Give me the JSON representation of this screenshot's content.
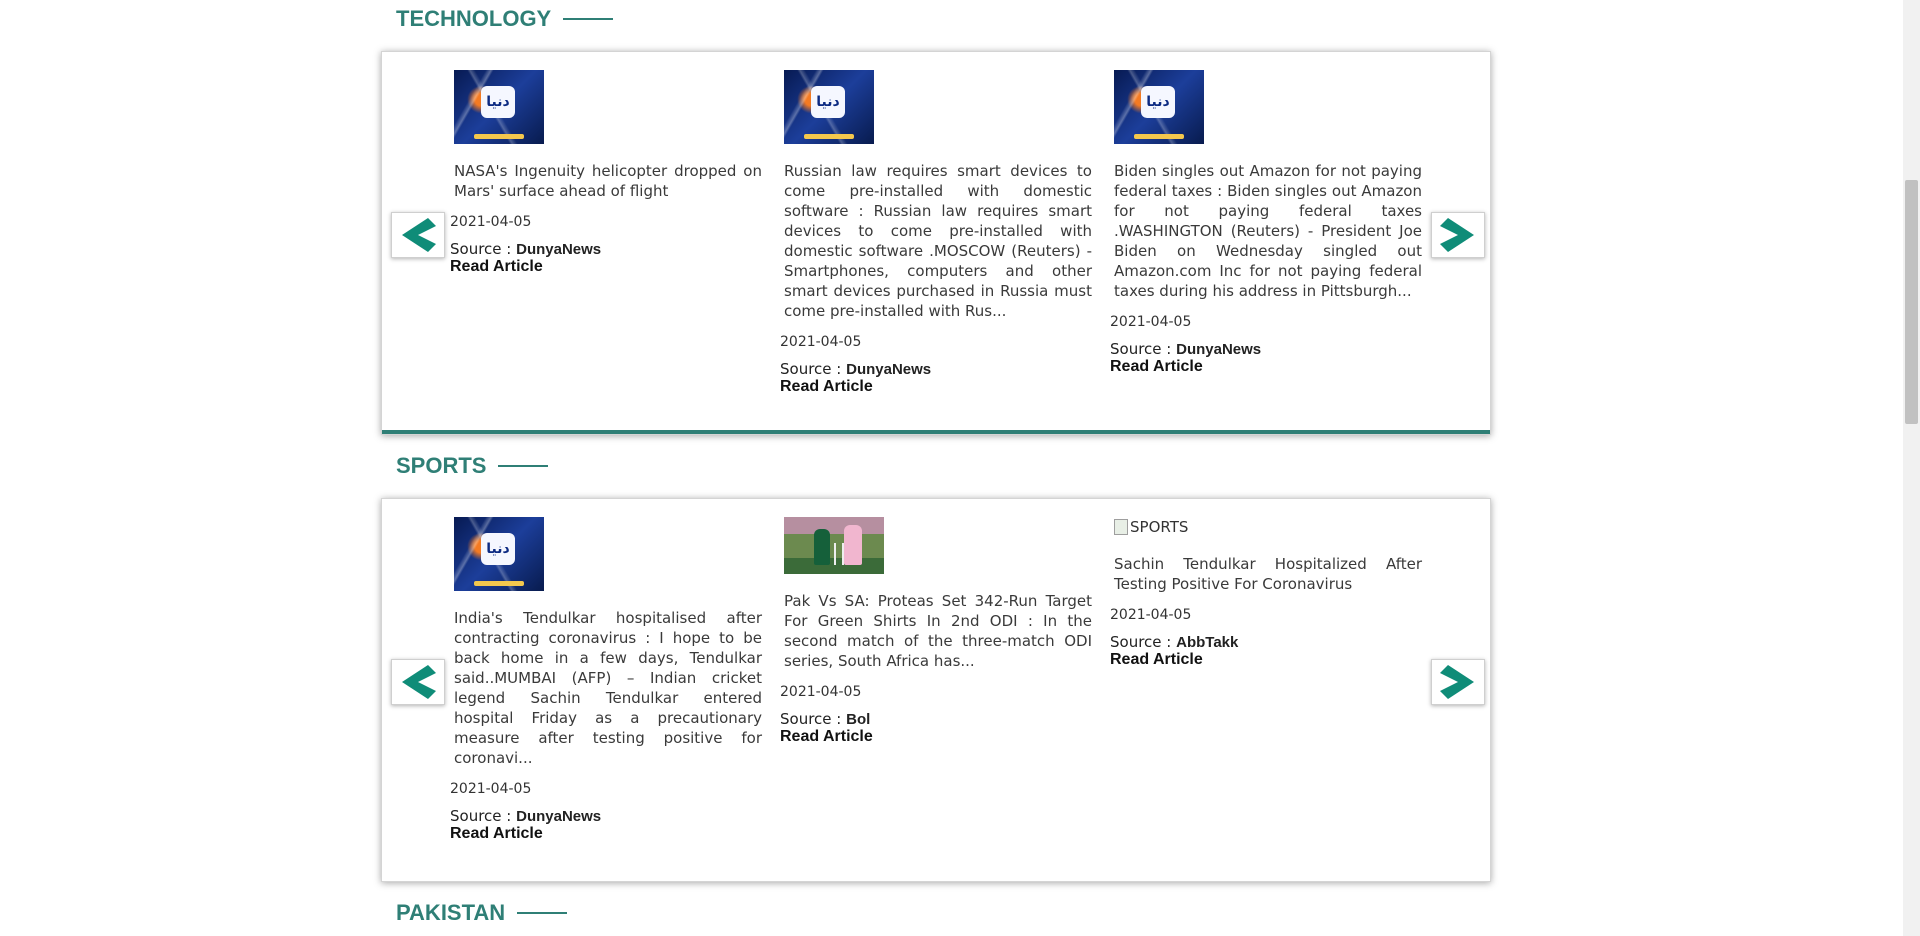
{
  "sections": [
    {
      "title": "TECHNOLOGY",
      "articles": [
        {
          "image_alt": "DunyaNews",
          "text": "NASA's Ingenuity helicopter dropped on Mars' surface ahead of flight",
          "date": "2021-04-05",
          "source_label": "Source :",
          "source": "DunyaNews",
          "read_label": "Read Article"
        },
        {
          "image_alt": "DunyaNews",
          "text": "Russian law requires smart devices to come pre-installed with domestic software : Russian law requires smart devices to come pre-installed with domestic software .MOSCOW (Reuters) - Smartphones, computers and other smart devices purchased in Russia must come pre-installed with Rus...",
          "date": "2021-04-05",
          "source_label": "Source :",
          "source": "DunyaNews",
          "read_label": "Read Article"
        },
        {
          "image_alt": "DunyaNews",
          "text": "Biden singles out Amazon for not paying federal taxes : Biden singles out Amazon for not paying federal taxes .WASHINGTON (Reuters) - President Joe Biden on Wednesday singled out Amazon.com Inc for not paying federal taxes during his address in Pittsburgh...",
          "date": "2021-04-05",
          "source_label": "Source :",
          "source": "DunyaNews",
          "read_label": "Read Article"
        }
      ]
    },
    {
      "title": "SPORTS",
      "articles": [
        {
          "image_alt": "DunyaNews",
          "text": "India's Tendulkar hospitalised after contracting coronavirus : I hope to be back home in a few days, Tendulkar said..MUMBAI (AFP) – Indian cricket legend Sachin Tendulkar entered hospital Friday as a precautionary measure after testing positive for coronavi...",
          "date": "2021-04-05",
          "source_label": "Source :",
          "source": "DunyaNews",
          "read_label": "Read Article"
        },
        {
          "image_alt": "Bol",
          "text": "Pak Vs SA: Proteas Set 342-Run Target For Green Shirts In 2nd ODI : In the second match of the three-match ODI series, South Africa has...",
          "date": "2021-04-05",
          "source_label": "Source :",
          "source": "Bol",
          "read_label": "Read Article"
        },
        {
          "image_alt": "SPORTS",
          "text": "Sachin Tendulkar Hospitalized After Testing Positive For Coronavirus",
          "date": "2021-04-05",
          "source_label": "Source :",
          "source": "AbbTakk",
          "read_label": "Read Article"
        }
      ]
    },
    {
      "title": "PAKISTAN"
    }
  ],
  "icons": {
    "prev": "chevron-left-icon",
    "next": "chevron-right-icon",
    "logo_glyph": "دنیا"
  },
  "colors": {
    "accent": "#2f7f76",
    "arrow": "#0f8c78"
  }
}
